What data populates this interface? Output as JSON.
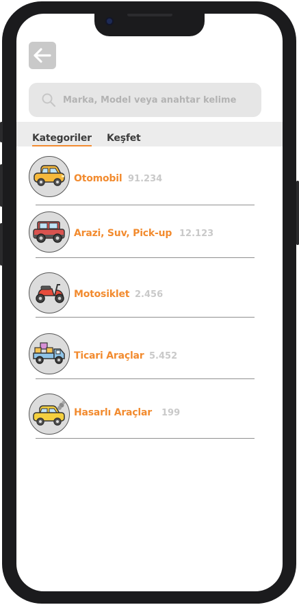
{
  "header": {
    "back_icon": "arrow-left-icon"
  },
  "search": {
    "placeholder": "Marka, Model veya anahtar kelime",
    "value": ""
  },
  "tabs": [
    {
      "label": "Kategoriler",
      "active": true
    },
    {
      "label": "Keşfet",
      "active": false
    }
  ],
  "categories": [
    {
      "name": "Otomobil",
      "count": "91.234",
      "icon": "car-icon"
    },
    {
      "name": "Arazi, Suv, Pick-up",
      "count": "12.123",
      "icon": "suv-icon"
    },
    {
      "name": "Motosiklet",
      "count": "2.456",
      "icon": "scooter-icon"
    },
    {
      "name": "Ticari Araçlar",
      "count": "5.452",
      "icon": "truck-icon"
    },
    {
      "name": "Hasarlı Araçlar",
      "count": "199",
      "icon": "damaged-car-icon"
    }
  ],
  "colors": {
    "accent": "#f28b2f",
    "count": "#c9c9c9",
    "frame": "#1b1b1d"
  }
}
